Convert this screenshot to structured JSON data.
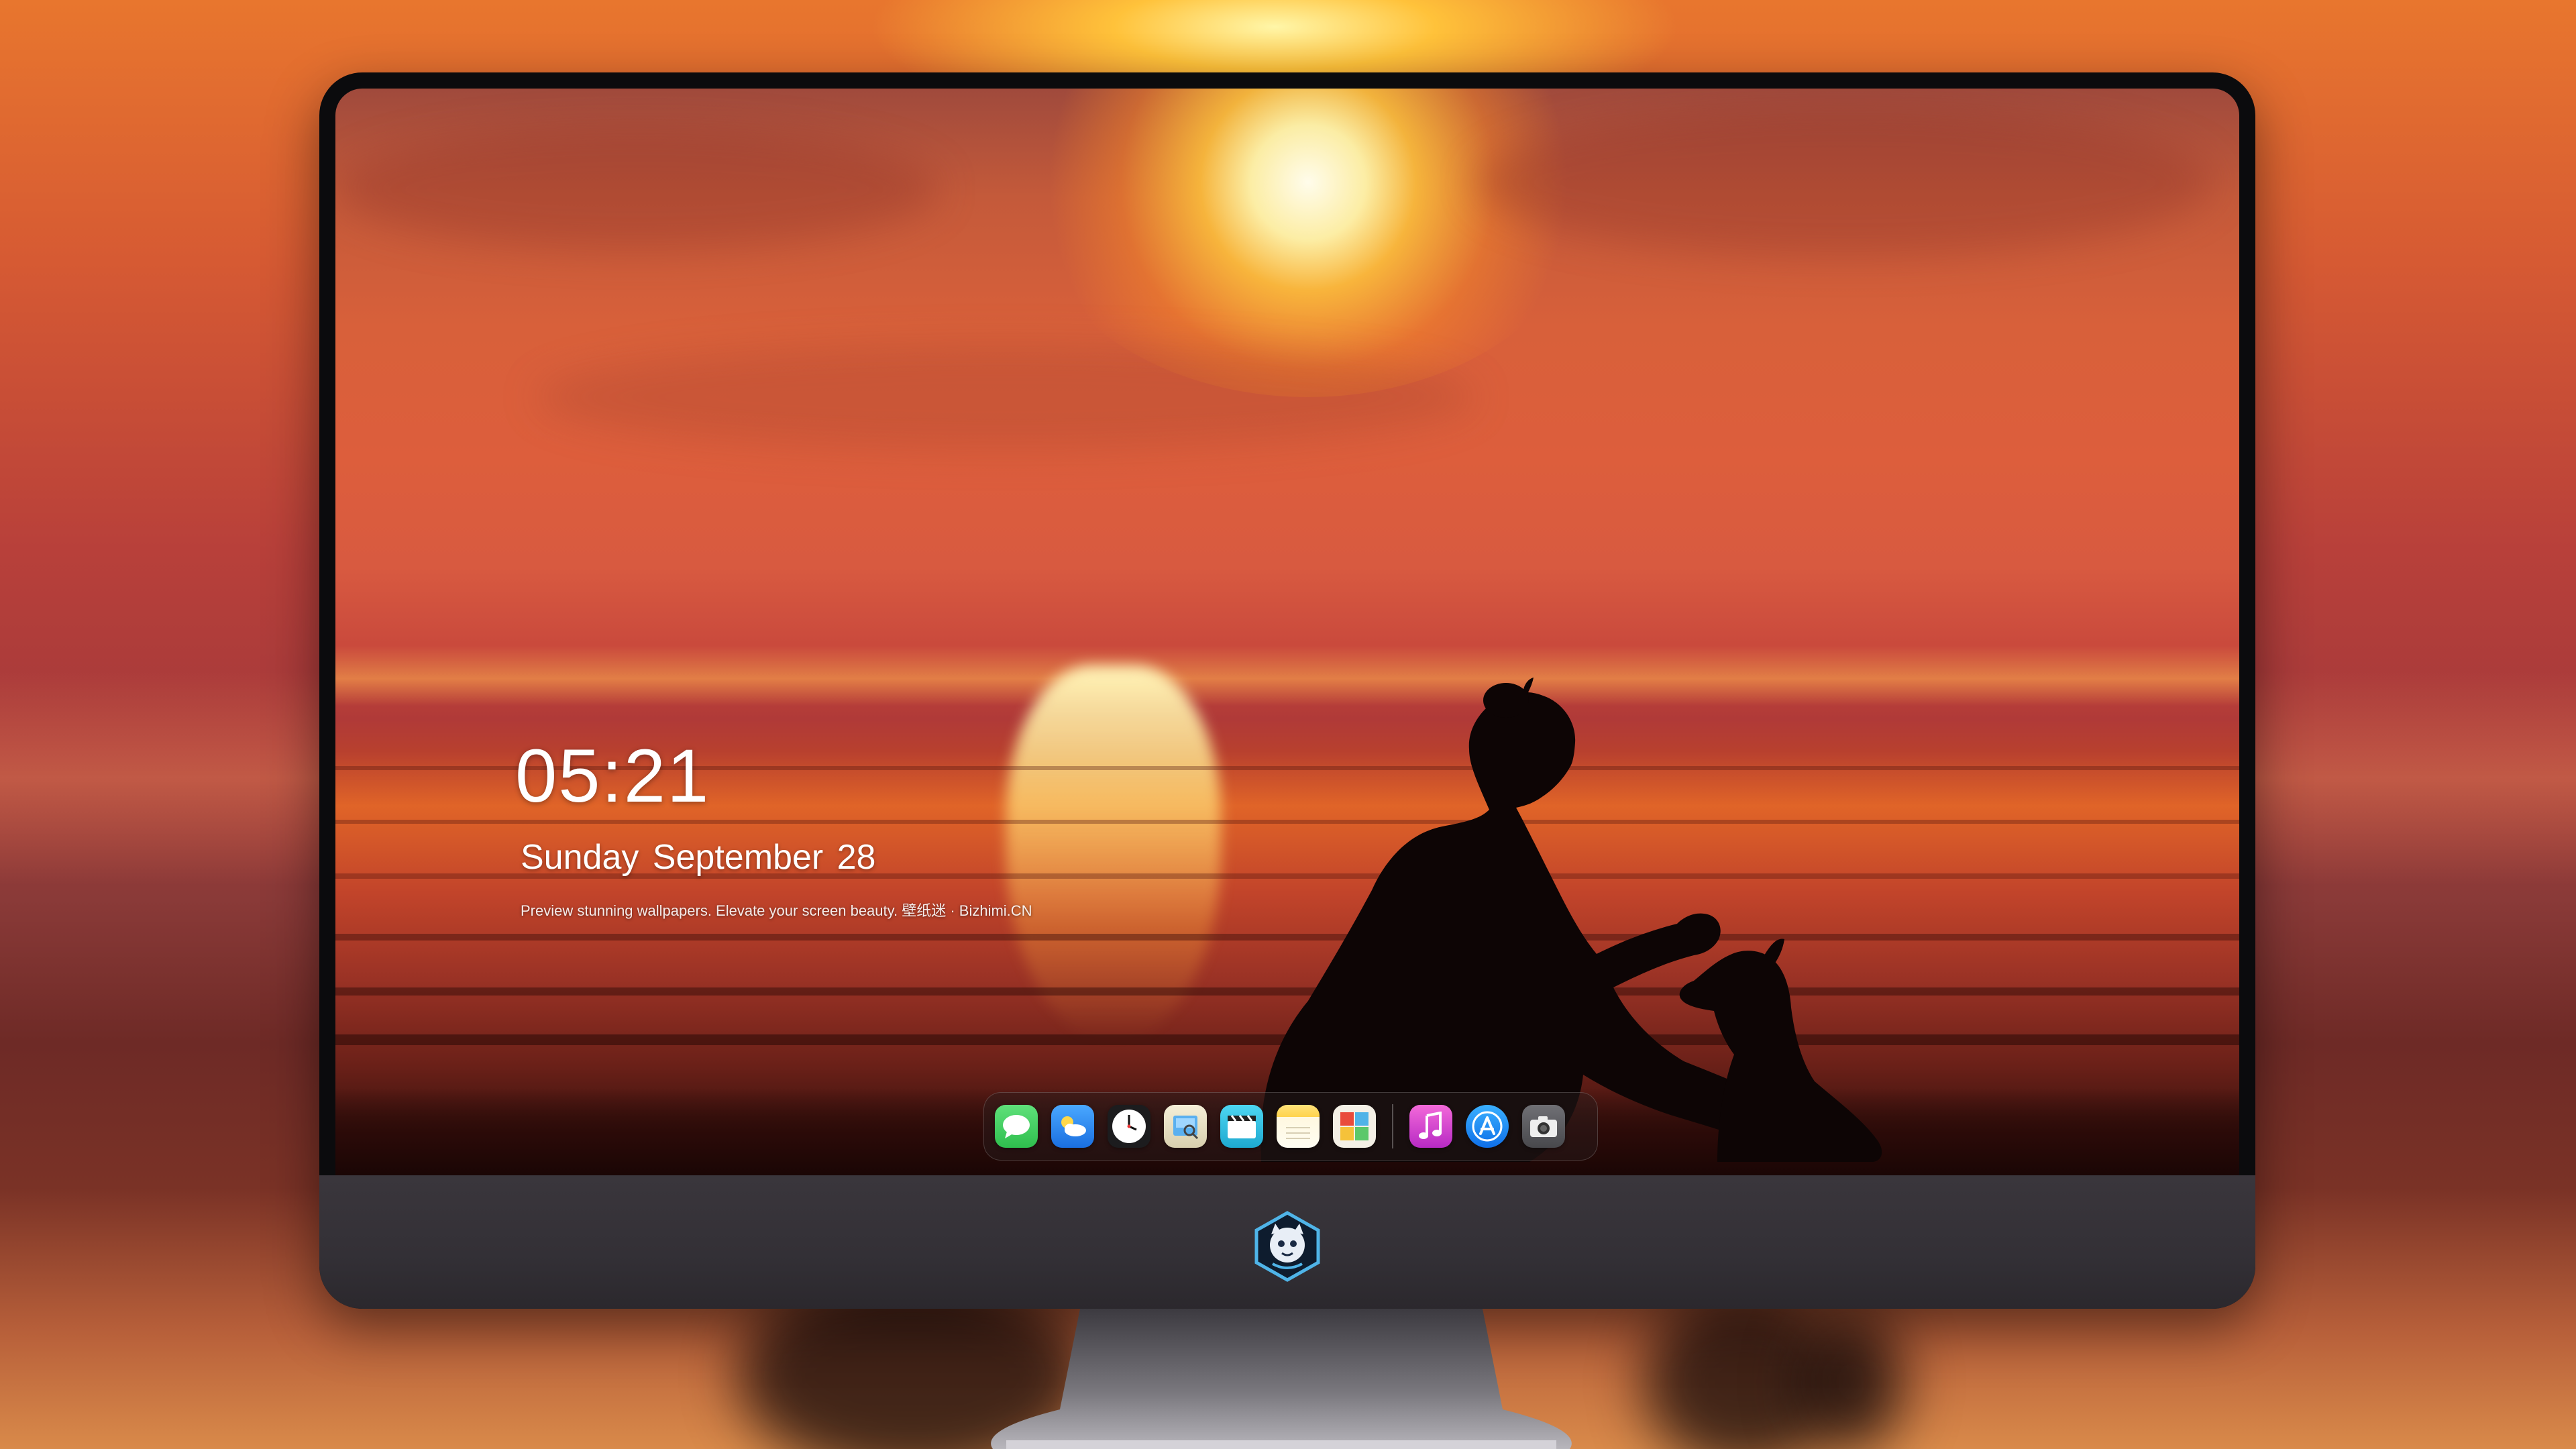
{
  "lock_screen": {
    "time": "05:21",
    "date": "Sunday September  28",
    "caption": "Preview stunning wallpapers. Elevate your screen beauty. 壁纸迷 · Bizhimi.CN"
  },
  "dock": {
    "apps": [
      {
        "name": "Messages",
        "icon": "messages-icon",
        "color": "#34c759"
      },
      {
        "name": "Weather",
        "icon": "weather-icon",
        "color": "#2f8bff"
      },
      {
        "name": "Clock",
        "icon": "clock-icon",
        "color": "#1c1c1e"
      },
      {
        "name": "Preview",
        "icon": "preview-icon",
        "color": "#e8e2cc"
      },
      {
        "name": "Clips",
        "icon": "clips-icon",
        "color": "#2ec4e8"
      },
      {
        "name": "Notes",
        "icon": "notes-icon",
        "color": "#ffd34d"
      },
      {
        "name": "Photo Booth",
        "icon": "photo-booth-icon",
        "color": "#f4f0e6"
      },
      {
        "name": "iTunes",
        "icon": "itunes-icon",
        "color": "#d93dc2"
      },
      {
        "name": "App Store",
        "icon": "app-store-icon",
        "color": "#1a8cff"
      },
      {
        "name": "Camera",
        "icon": "camera-icon",
        "color": "#5a5a5e"
      }
    ]
  },
  "chin": {
    "logo_icon": "mascot-logo-icon"
  }
}
